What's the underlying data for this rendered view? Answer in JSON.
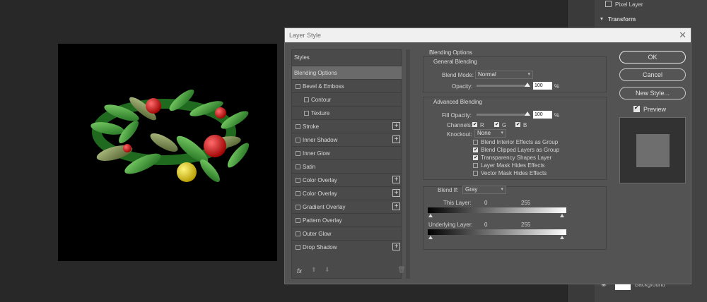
{
  "right_panel": {
    "pixel_layer": "Pixel Layer",
    "transform": "Transform",
    "background": "Background"
  },
  "dialog": {
    "title": "Layer Style",
    "styles_header": "Styles",
    "styles": [
      {
        "label": "Blending Options",
        "selected": true,
        "checkbox": false,
        "plus": false,
        "indent": false
      },
      {
        "label": "Bevel & Emboss",
        "checkbox": true,
        "plus": false,
        "indent": false
      },
      {
        "label": "Contour",
        "checkbox": true,
        "plus": false,
        "indent": true
      },
      {
        "label": "Texture",
        "checkbox": true,
        "plus": false,
        "indent": true
      },
      {
        "label": "Stroke",
        "checkbox": true,
        "plus": true,
        "indent": false
      },
      {
        "label": "Inner Shadow",
        "checkbox": true,
        "plus": true,
        "indent": false
      },
      {
        "label": "Inner Glow",
        "checkbox": true,
        "plus": false,
        "indent": false
      },
      {
        "label": "Satin",
        "checkbox": true,
        "plus": false,
        "indent": false
      },
      {
        "label": "Color Overlay",
        "checkbox": true,
        "plus": true,
        "indent": false
      },
      {
        "label": "Color Overlay",
        "checkbox": true,
        "plus": true,
        "indent": false
      },
      {
        "label": "Gradient Overlay",
        "checkbox": true,
        "plus": true,
        "indent": false
      },
      {
        "label": "Pattern Overlay",
        "checkbox": true,
        "plus": false,
        "indent": false
      },
      {
        "label": "Outer Glow",
        "checkbox": true,
        "plus": false,
        "indent": false
      },
      {
        "label": "Drop Shadow",
        "checkbox": true,
        "plus": true,
        "indent": false
      }
    ],
    "fx_label": "fx",
    "blending_options": {
      "title": "Blending Options",
      "general": {
        "title": "General Blending",
        "blend_mode_label": "Blend Mode:",
        "blend_mode": "Normal",
        "opacity_label": "Opacity:",
        "opacity": "100",
        "opacity_unit": "%",
        "opacity_fraction": 1.0
      },
      "advanced": {
        "title": "Advanced Blending",
        "fill_opacity_label": "Fill Opacity:",
        "fill_opacity": "100",
        "fill_opacity_unit": "%",
        "fill_fraction": 1.0,
        "channels_label": "Channels:",
        "channel_r": "R",
        "channel_g": "G",
        "channel_b": "B",
        "knockout_label": "Knockout:",
        "knockout": "None",
        "options": [
          {
            "label": "Blend Interior Effects as Group",
            "checked": false
          },
          {
            "label": "Blend Clipped Layers as Group",
            "checked": true
          },
          {
            "label": "Transparency Shapes Layer",
            "checked": true
          },
          {
            "label": "Layer Mask Hides Effects",
            "checked": false
          },
          {
            "label": "Vector Mask Hides Effects",
            "checked": false
          }
        ]
      },
      "blend_if": {
        "label": "Blend If:",
        "value": "Gray",
        "this_layer_label": "This Layer:",
        "this_layer_low": "0",
        "this_layer_high": "255",
        "underlying_label": "Underlying Layer:",
        "underlying_low": "0",
        "underlying_high": "255"
      }
    },
    "buttons": {
      "ok": "OK",
      "cancel": "Cancel",
      "new_style": "New Style..."
    },
    "preview_label": "Preview"
  }
}
